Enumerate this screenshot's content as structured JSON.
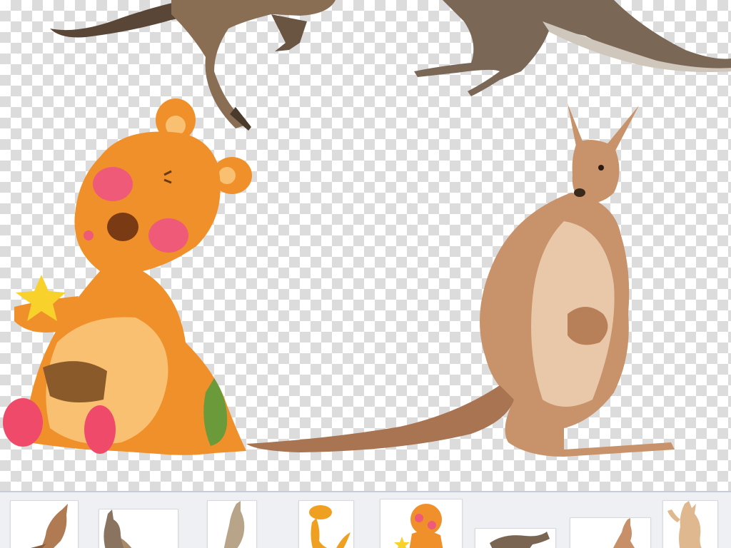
{
  "colors": {
    "checker_light": "#ffffff",
    "checker_dark": "#dcdcdc",
    "strip_background": "#eef0f4",
    "cartoon_orange": "#f0902a",
    "cartoon_cheek": "#ee5a78",
    "cartoon_foot": "#f04a6a",
    "cartoon_belly": "#f8c070",
    "cartoon_patch": "#8a5a2a",
    "cartoon_green": "#6a9a3a",
    "star_yellow": "#f8d22a",
    "kangaroo_tan": "#c8926a",
    "kangaroo_belly": "#e8c8a8",
    "kangaroo_dark": "#7a6a5a"
  },
  "canvas": {
    "name": "transparent-background-canvas",
    "illustrations": [
      {
        "name": "kangaroo-photo-top-left",
        "kind": "photo"
      },
      {
        "name": "kangaroo-photo-top-right",
        "kind": "photo"
      },
      {
        "name": "cartoon-kangaroo-with-star",
        "kind": "cartoon"
      },
      {
        "name": "kangaroo-with-joey",
        "kind": "illustration"
      }
    ]
  },
  "thumbnails": [
    {
      "name": "thumbnail-kangaroo-standing"
    },
    {
      "name": "thumbnail-kangaroo-boxing"
    },
    {
      "name": "thumbnail-kangaroo-pale"
    },
    {
      "name": "thumbnail-cartoon-kangaroo-yellow"
    },
    {
      "name": "thumbnail-cartoon-kangaroo-star"
    },
    {
      "name": "thumbnail-kangaroo-crouching"
    },
    {
      "name": "thumbnail-kangaroo-small"
    },
    {
      "name": "thumbnail-kangaroo-waving"
    }
  ]
}
